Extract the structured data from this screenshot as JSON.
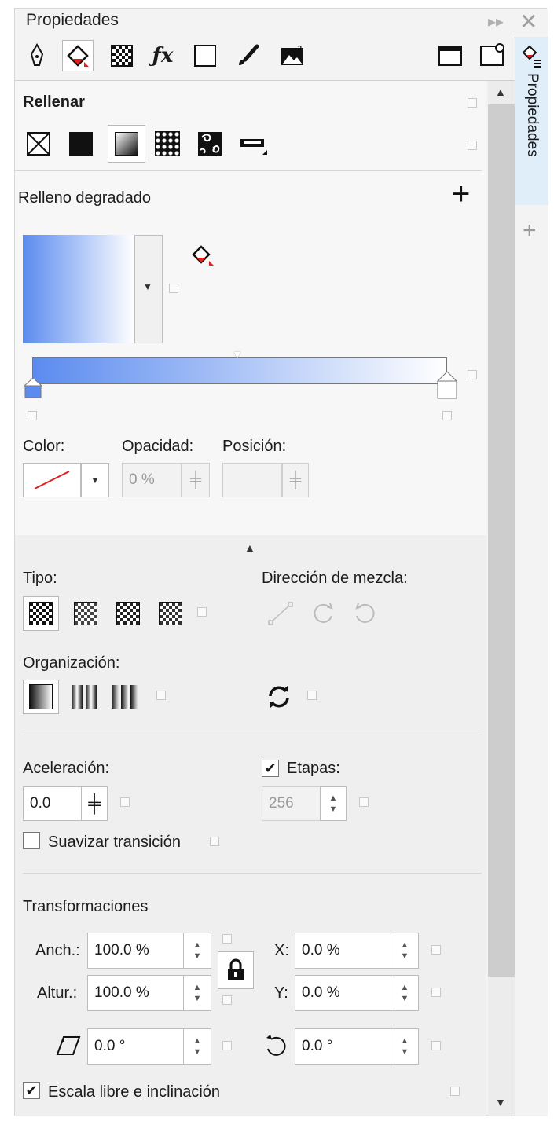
{
  "window": {
    "title": "Propiedades"
  },
  "side_tab": {
    "label": "Propiedades"
  },
  "toolbar": {
    "icons": [
      "pen-icon",
      "fill-icon",
      "transparency-icon",
      "fx-icon",
      "frame-icon",
      "brush-icon",
      "image-info-icon",
      "window-icon",
      "summary-icon"
    ],
    "selected": "fill-icon"
  },
  "fill_section": {
    "heading": "Rellenar",
    "fill_types": [
      "no-fill",
      "uniform-fill",
      "fountain-fill",
      "vector-pattern-fill",
      "bitmap-pattern-fill",
      "postscript-fill"
    ],
    "selected_type": "fountain-fill"
  },
  "gradient": {
    "title": "Relleno degradado",
    "start_color": "#5b8bef",
    "end_color": "#ffffff",
    "color_label": "Color:",
    "opacity_label": "Opacidad:",
    "opacity_value": "0 %",
    "position_label": "Posición:",
    "position_value": ""
  },
  "type_section": {
    "type_label": "Tipo:",
    "blend_label": "Dirección de mezcla:",
    "arrangement_label": "Organización:"
  },
  "acceleration": {
    "label": "Aceleración:",
    "value": "0.0",
    "steps_label": "Etapas:",
    "steps_checked": true,
    "steps_value": "256",
    "smooth_label": "Suavizar transición",
    "smooth_checked": false
  },
  "transform": {
    "heading": "Transformaciones",
    "width_label": "Anch.:",
    "width_value": "100.0 %",
    "height_label": "Altur.:",
    "height_value": "100.0 %",
    "x_label": "X:",
    "x_value": "0.0 %",
    "y_label": "Y:",
    "y_value": "0.0 %",
    "skew_value": "0.0 °",
    "rotate_value": "0.0 °",
    "free_scale_label": "Escala libre e inclinación",
    "free_scale_checked": true
  }
}
